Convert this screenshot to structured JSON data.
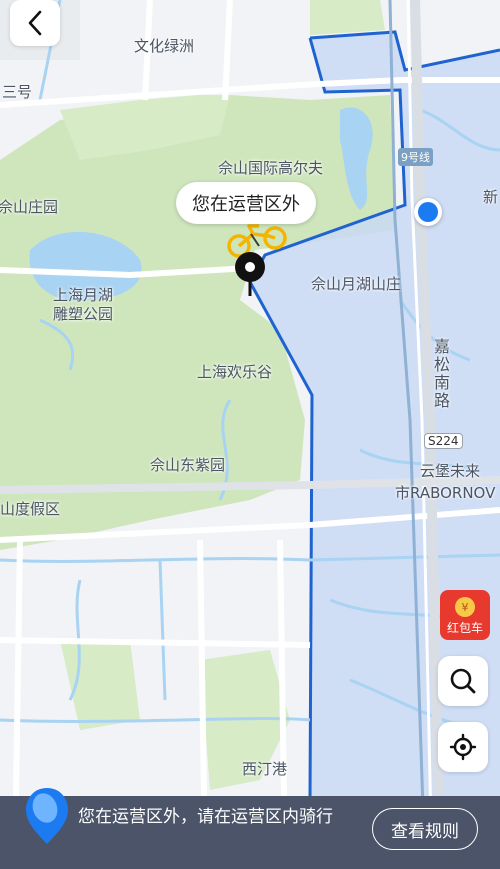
{
  "map": {
    "labels": {
      "wenhua": "文化绿洲",
      "sanhao": "三号",
      "golf": "佘山国际高尔夫",
      "sheshanzhuang": "佘山庄园",
      "yuehu": "上海月湖",
      "diaosu": "雕塑公园",
      "yuehushanzhuang": "佘山月湖山庄",
      "huanlegu": "上海欢乐谷",
      "dongziyuan": "佘山东紫园",
      "dujiaqu": "山度假区",
      "xin": "新",
      "xidinggang": "西汀港",
      "yunbao": "云堡未来",
      "rabornov": "市RABORNOV",
      "jiasong": "嘉松南路",
      "road_s224": "S224",
      "metro_line": "9号线"
    },
    "zone_color": "#1e63d0"
  },
  "header": {
    "back_icon": "chevron-left-icon"
  },
  "bubble": {
    "text": "您在运营区外"
  },
  "side_buttons": {
    "red_packet_label": "红包车",
    "search_icon": "search-icon",
    "locate_icon": "locate-icon"
  },
  "bottom": {
    "message": "您在运营区外，请在运营区内骑行",
    "rules_button": "查看规则"
  }
}
